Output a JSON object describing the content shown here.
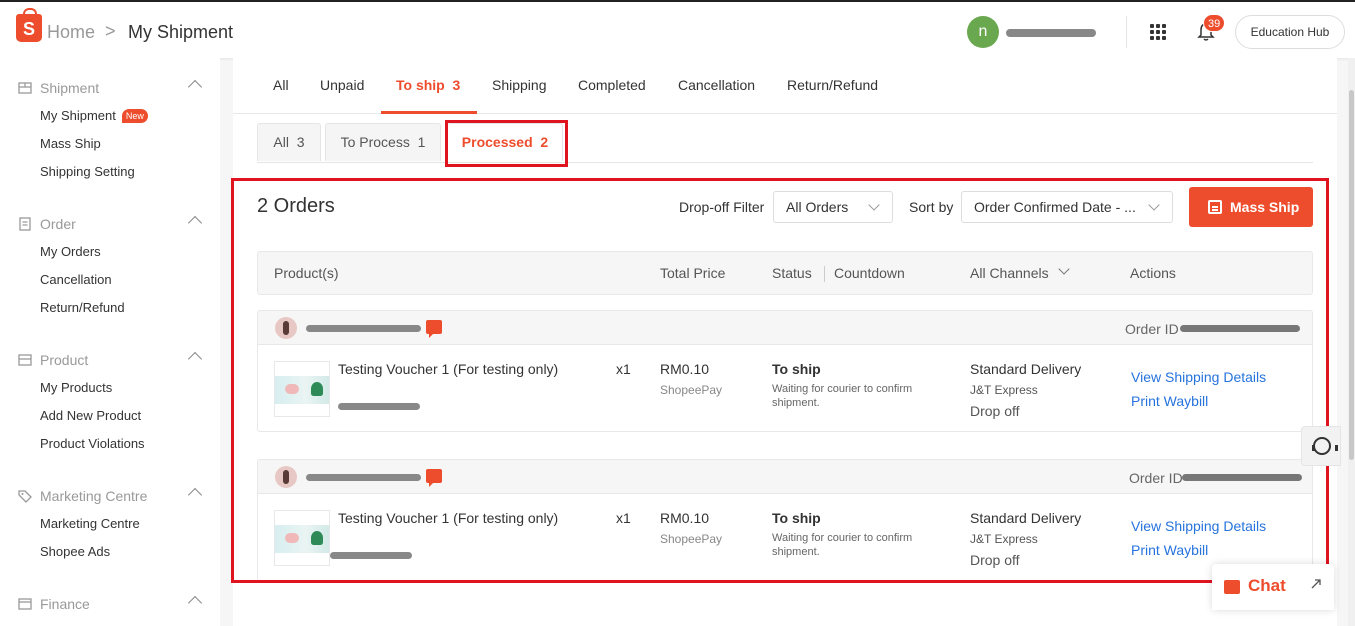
{
  "header": {
    "logo_letter": "S",
    "breadcrumb_home": "Home",
    "breadcrumb_sep": ">",
    "breadcrumb_current": "My Shipment",
    "user_initial": "n",
    "notification_count": "39",
    "education_hub": "Education Hub"
  },
  "sidebar": {
    "sections": [
      {
        "title": "Shipment",
        "icon": "shipment-icon",
        "items": [
          "My Shipment",
          "Mass Ship",
          "Shipping Setting"
        ],
        "badge": "New"
      },
      {
        "title": "Order",
        "icon": "order-icon",
        "items": [
          "My Orders",
          "Cancellation",
          "Return/Refund"
        ]
      },
      {
        "title": "Product",
        "icon": "product-icon",
        "items": [
          "My Products",
          "Add New Product",
          "Product Violations"
        ]
      },
      {
        "title": "Marketing Centre",
        "icon": "tag-icon",
        "items": [
          "Marketing Centre",
          "Shopee Ads"
        ]
      },
      {
        "title": "Finance",
        "icon": "finance-icon",
        "items": []
      }
    ]
  },
  "tabs": [
    {
      "label": "All"
    },
    {
      "label": "Unpaid"
    },
    {
      "label": "To ship",
      "count": "3",
      "active": true
    },
    {
      "label": "Shipping"
    },
    {
      "label": "Completed"
    },
    {
      "label": "Cancellation"
    },
    {
      "label": "Return/Refund"
    }
  ],
  "subtabs": [
    {
      "label": "All",
      "count": "3"
    },
    {
      "label": "To Process",
      "count": "1"
    },
    {
      "label": "Processed",
      "count": "2",
      "active": true
    }
  ],
  "toolbar": {
    "orders_count": "2 Orders",
    "dropoff_label": "Drop-off Filter",
    "dropoff_value": "All Orders",
    "sortby_label": "Sort by",
    "sortby_value": "Order Confirmed Date - ...",
    "mass_ship": "Mass Ship"
  },
  "table_headers": {
    "product": "Product(s)",
    "total_price": "Total Price",
    "status": "Status",
    "countdown": "Countdown",
    "channels": "All Channels",
    "actions": "Actions"
  },
  "orders": [
    {
      "order_id_label": "Order ID",
      "product_name": "Testing Voucher 1 (For testing only)",
      "qty": "x1",
      "price": "RM0.10",
      "payment": "ShopeePay",
      "status": "To ship",
      "status_desc": "Waiting for courier to confirm shipment.",
      "channel": "Standard Delivery",
      "courier": "J&T Express",
      "method": "Drop off",
      "action_1": "View Shipping Details",
      "action_2": "Print Waybill"
    },
    {
      "order_id_label": "Order ID",
      "product_name": "Testing Voucher 1 (For testing only)",
      "qty": "x1",
      "price": "RM0.10",
      "payment": "ShopeePay",
      "status": "To ship",
      "status_desc": "Waiting for courier to confirm shipment.",
      "channel": "Standard Delivery",
      "courier": "J&T Express",
      "method": "Drop off",
      "action_1": "View Shipping Details",
      "action_2": "Print Waybill"
    }
  ],
  "chat_widget": {
    "label": "Chat"
  },
  "colors": {
    "accent": "#ee4d2d",
    "link": "#2673dd",
    "highlight_box": "#e0141e"
  }
}
